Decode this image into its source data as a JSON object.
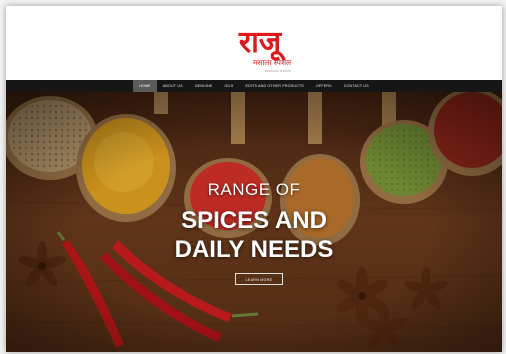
{
  "brand": {
    "logo_devanagari": "राजू",
    "logo_subtitle": "मसाला स्पेशल",
    "logo_tagline": "premium quality"
  },
  "nav": {
    "items": [
      {
        "label": "HOME",
        "active": true
      },
      {
        "label": "ABOUT US",
        "active": false
      },
      {
        "label": "GENUINE",
        "active": false
      },
      {
        "label": "OILS",
        "active": false
      },
      {
        "label": "EDITS AND OTHER PRODUCTS",
        "active": false
      },
      {
        "label": "OFFERS",
        "active": false
      },
      {
        "label": "CONTACT US",
        "active": false
      }
    ]
  },
  "hero": {
    "kicker": "RANGE OF",
    "headline_line1": "SPICES AND",
    "headline_line2": "DAILY NEEDS",
    "cta_label": "LEARN MORE"
  },
  "colors": {
    "brand_red": "#e0191b",
    "nav_bg": "#161616",
    "table_wood": "#6b3a1c"
  }
}
